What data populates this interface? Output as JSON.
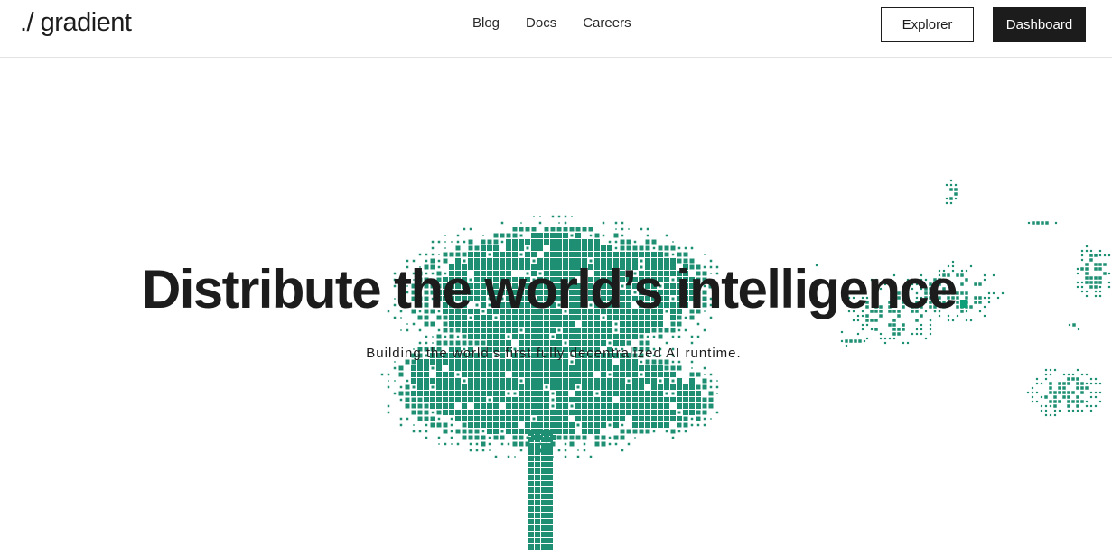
{
  "header": {
    "logo": "./ gradient",
    "nav": [
      "Blog",
      "Docs",
      "Careers"
    ],
    "explorer_label": "Explorer",
    "dashboard_label": "Dashboard"
  },
  "hero": {
    "title": "Distribute the world’s intelligence",
    "title_accent": ".",
    "subtitle": "Building the world’s first fully decentralized AI runtime."
  },
  "colors": {
    "accent": "#0e9f79",
    "pixel_tree": "#1f8f73",
    "text": "#1c1c1c",
    "button_dark": "#1c1c1c"
  },
  "illustration": {
    "icon": "pixelated-tree-icon"
  }
}
